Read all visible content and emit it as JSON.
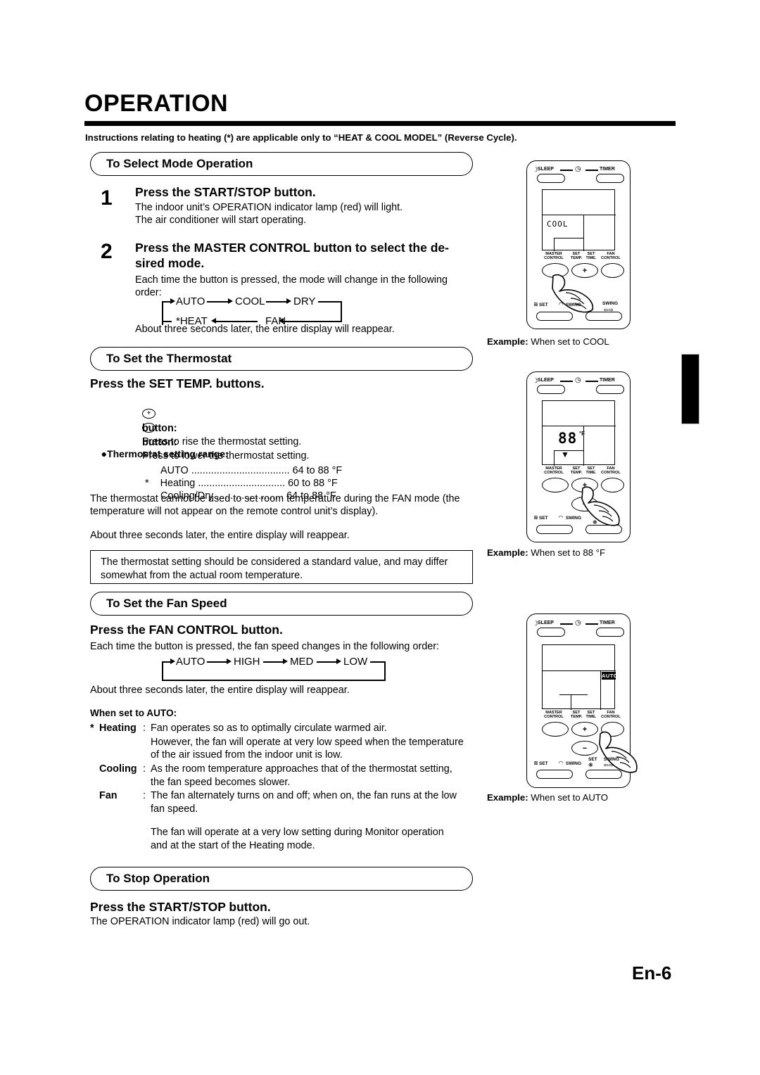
{
  "page": {
    "title": "OPERATION",
    "intro": "Instructions relating to heating (*) are applicable only to “HEAT & COOL MODEL” (Reverse Cycle).",
    "folio": "En-6"
  },
  "sections": {
    "select_mode": {
      "bar_label": "To Select Mode Operation",
      "step1": {
        "number": "1",
        "heading": "Press the START/STOP button.",
        "line1": "The indoor unit’s OPERATION indicator lamp (red) will light.",
        "line2": "The air conditioner will start operating."
      },
      "step2": {
        "number": "2",
        "heading_line1": "Press the MASTER CONTROL button to select the de-",
        "heading_line2": "sired mode.",
        "intro_line1": "Each time the button is pressed, the mode will change in the following",
        "intro_line2": "order:",
        "cycle_top": [
          "AUTO",
          "COOL",
          "DRY"
        ],
        "cycle_bottom": [
          "*HEAT",
          "FAN"
        ],
        "outro": "About three seconds later, the entire display will reappear."
      }
    },
    "thermostat": {
      "bar_label": "To Set the Thermostat",
      "heading": "Press the SET TEMP. buttons.",
      "plus_glyph": "+",
      "plus_label": "button:",
      "plus_text": "Press to rise the thermostat setting.",
      "minus_glyph": "-",
      "minus_label": "button:",
      "minus_text": "Press to lower the thermostat setting.",
      "range_title": "Thermostat setting range:",
      "ranges": [
        {
          "star": "",
          "name": "AUTO",
          "leader": "...................................",
          "value": "64 to 88 °F"
        },
        {
          "star": "*",
          "name": "Heating",
          "leader": "...............................",
          "value": "60 to 88 °F"
        },
        {
          "star": "",
          "name": "Cooling/Dry",
          "leader": "........................",
          "value": "64 to 88 °F"
        }
      ],
      "para_line1": "The thermostat cannot be used to set room temperature during the FAN mode (the",
      "para_line2": "temperature will not appear on the remote control unit’s display).",
      "outro": "About three seconds later, the entire display will reappear.",
      "note_line1": "The thermostat setting should be considered a standard value, and may differ",
      "note_line2": "somewhat from the actual room temperature."
    },
    "fan_speed": {
      "bar_label": "To Set the Fan Speed",
      "heading": "Press the FAN CONTROL button.",
      "intro": "Each time the button is pressed, the fan speed changes in the following order:",
      "cycle": [
        "AUTO",
        "HIGH",
        "MED",
        "LOW"
      ],
      "outro": "About three seconds later, the entire display will reappear.",
      "auto_title": "When set to AUTO:",
      "rows": [
        {
          "star": "*",
          "label": "Heating",
          "colon": ":",
          "lines": [
            "Fan operates so as to optimally circulate warmed air.",
            "However, the fan will operate at very low speed when the temperature",
            "of the air issued from the indoor unit is low."
          ]
        },
        {
          "star": "",
          "label": "Cooling",
          "colon": ":",
          "lines": [
            "As the room temperature approaches that of the thermostat setting,",
            "the fan speed becomes slower."
          ]
        },
        {
          "star": "",
          "label": "Fan",
          "colon": ":",
          "lines": [
            "The fan alternately turns on and off; when on, the fan runs at the low",
            "fan speed."
          ]
        }
      ],
      "tail_line1": "The fan will operate at a very low setting during Monitor operation",
      "tail_line2": "and at the start of the Heating mode."
    },
    "stop": {
      "bar_label": "To Stop Operation",
      "heading": "Press the START/STOP button.",
      "text": "The OPERATION indicator lamp (red) will go out."
    }
  },
  "remotes": {
    "common": {
      "sleep": "SLEEP",
      "timer": "TIMER",
      "labels_row1": [
        "MASTER CONTROL",
        "SET TEMP.",
        "SET TIME.",
        "FAN CONTROL"
      ],
      "set": "SET",
      "swing": "SWING",
      "plus": "+",
      "minus": "−"
    },
    "items": [
      {
        "lcd_mode": "COOL",
        "lcd_temp": "",
        "lcd_fan": "",
        "caption_bold": "Example:",
        "caption_text": " When set to COOL",
        "pressed_button": "master-control"
      },
      {
        "lcd_mode": "",
        "lcd_temp": "88",
        "lcd_unit": "°F",
        "lcd_fan": "",
        "caption_bold": "Example:",
        "caption_text": " When set to 88 °F",
        "pressed_button": "set-temp-plus"
      },
      {
        "lcd_mode": "",
        "lcd_temp": "",
        "lcd_fan": "AUTO",
        "caption_bold": "Example:",
        "caption_text": " When set to AUTO",
        "pressed_button": "fan-control"
      }
    ]
  }
}
